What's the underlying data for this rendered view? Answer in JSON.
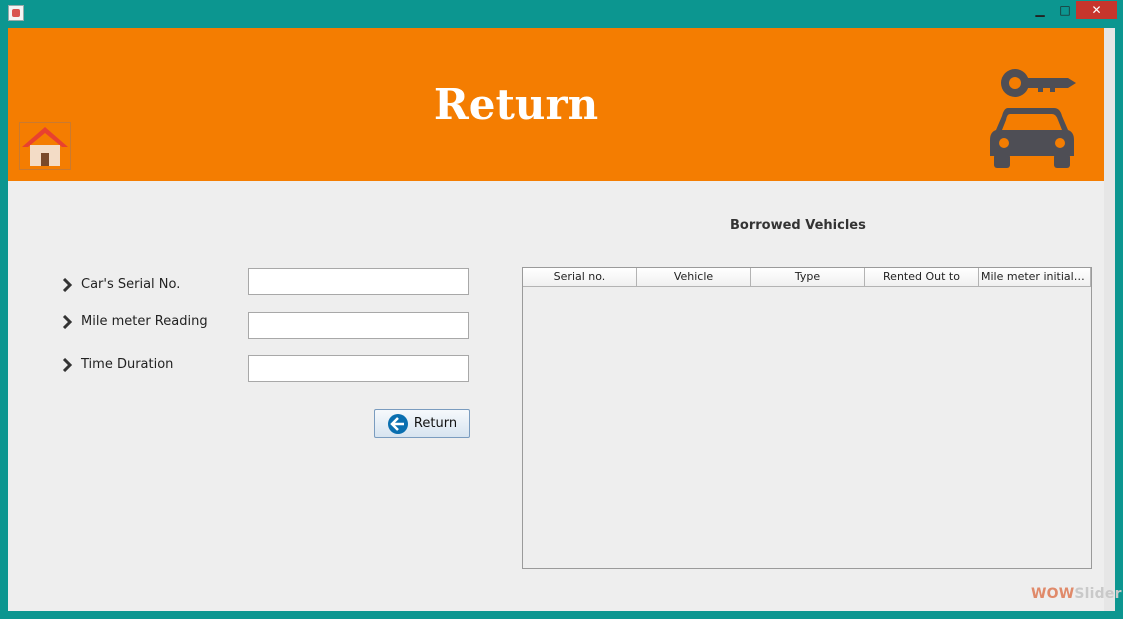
{
  "window": {
    "minimize_glyph": "▁",
    "maximize_glyph": "□",
    "close_glyph": "✕"
  },
  "header": {
    "title": "Return",
    "background": "#f47d01",
    "home_icon": "home-icon",
    "brand_icon": "car-key-icon"
  },
  "form": {
    "fields": [
      {
        "label": "Car's Serial No.",
        "value": ""
      },
      {
        "label": "Mile meter Reading",
        "value": ""
      },
      {
        "label": "Time Duration",
        "value": ""
      }
    ],
    "submit_label": "Return",
    "submit_icon": "arrow-left-circle-icon"
  },
  "table": {
    "caption": "Borrowed Vehicles",
    "columns": [
      "Serial no.",
      "Vehicle",
      "Type",
      "Rented Out to",
      "Mile meter initial rea..."
    ],
    "rows": []
  },
  "watermark": {
    "part1": "WOW",
    "part2": "Slider"
  },
  "colors": {
    "window_frame": "#0c9690",
    "close_button": "#c7352c",
    "icon_dark": "#4e4e55"
  }
}
